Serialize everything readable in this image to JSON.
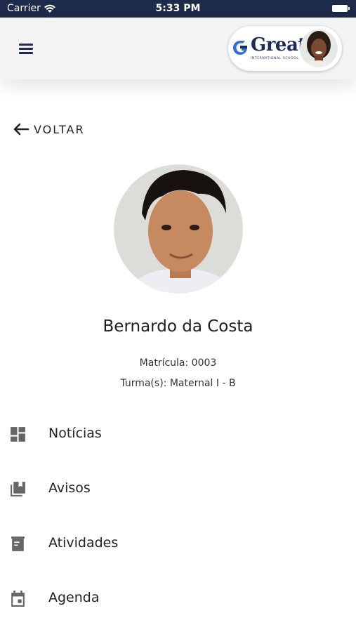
{
  "status_bar": {
    "carrier": "Carrier",
    "time": "5:33 PM"
  },
  "brand": {
    "name": "Great",
    "subtitle": "INTERNATIONAL SCHOOL",
    "accent": "#1e2a5a"
  },
  "nav": {
    "back_label": "VOLTAR"
  },
  "student": {
    "name": "Bernardo da Costa",
    "registration": "Matrícula: 0003",
    "classes": "Turma(s): Maternal I - B"
  },
  "menu": [
    {
      "label": "Notícias",
      "icon": "dashboard-icon"
    },
    {
      "label": "Avisos",
      "icon": "library-books-icon"
    },
    {
      "label": "Atividades",
      "icon": "assignment-icon"
    },
    {
      "label": "Agenda",
      "icon": "calendar-icon"
    }
  ]
}
